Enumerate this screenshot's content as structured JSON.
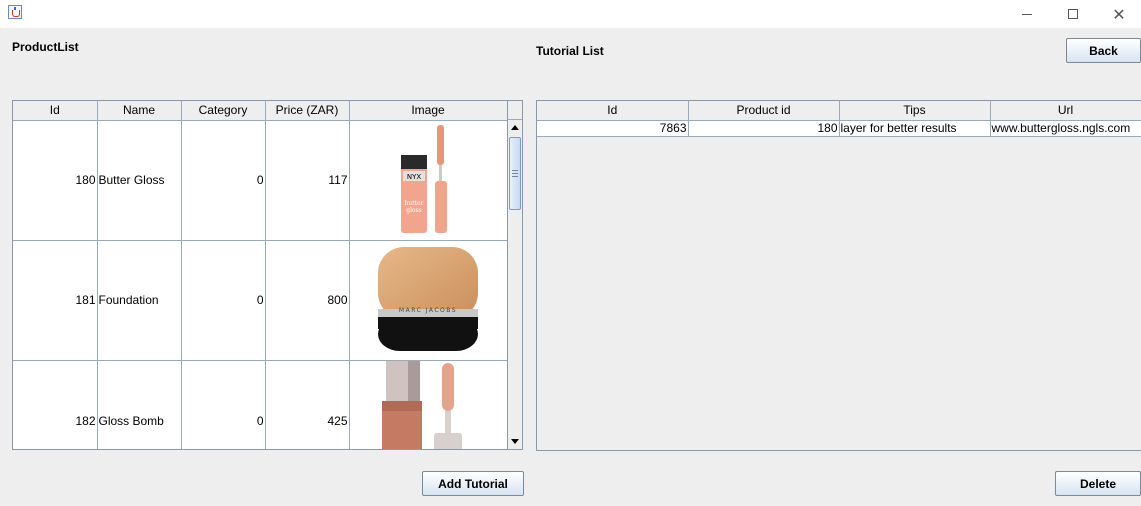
{
  "window": {
    "app_icon": "java-icon",
    "controls": [
      "minimize-icon",
      "maximize-icon",
      "close-icon"
    ],
    "close_glyph": "✕"
  },
  "product_section": {
    "title": "ProductList",
    "columns": [
      "Id",
      "Name",
      "Category",
      "Price (ZAR)",
      "Image"
    ],
    "rows": [
      {
        "id": "180",
        "name": "Butter Gloss",
        "category": "0",
        "price": "117",
        "image": "butter-gloss-image"
      },
      {
        "id": "181",
        "name": "Foundation",
        "category": "0",
        "price": "800",
        "image": "foundation-image"
      },
      {
        "id": "182",
        "name": "Gloss Bomb",
        "category": "0",
        "price": "425",
        "image": "gloss-bomb-image"
      }
    ],
    "add_button": "Add Tutorial"
  },
  "tutorial_section": {
    "title": "Tutorial List",
    "columns": [
      "Id",
      "Product id",
      "Tips",
      "Url"
    ],
    "rows": [
      {
        "id": "7863",
        "product_id": "180",
        "tips": "layer for better results",
        "url": "www.buttergloss.ngls.com"
      }
    ],
    "back_button": "Back",
    "delete_button": "Delete"
  },
  "colors": {
    "background": "#eeeeee",
    "grid": "#9aa9bb",
    "button_gradient_bottom": "#d7e4f2"
  }
}
